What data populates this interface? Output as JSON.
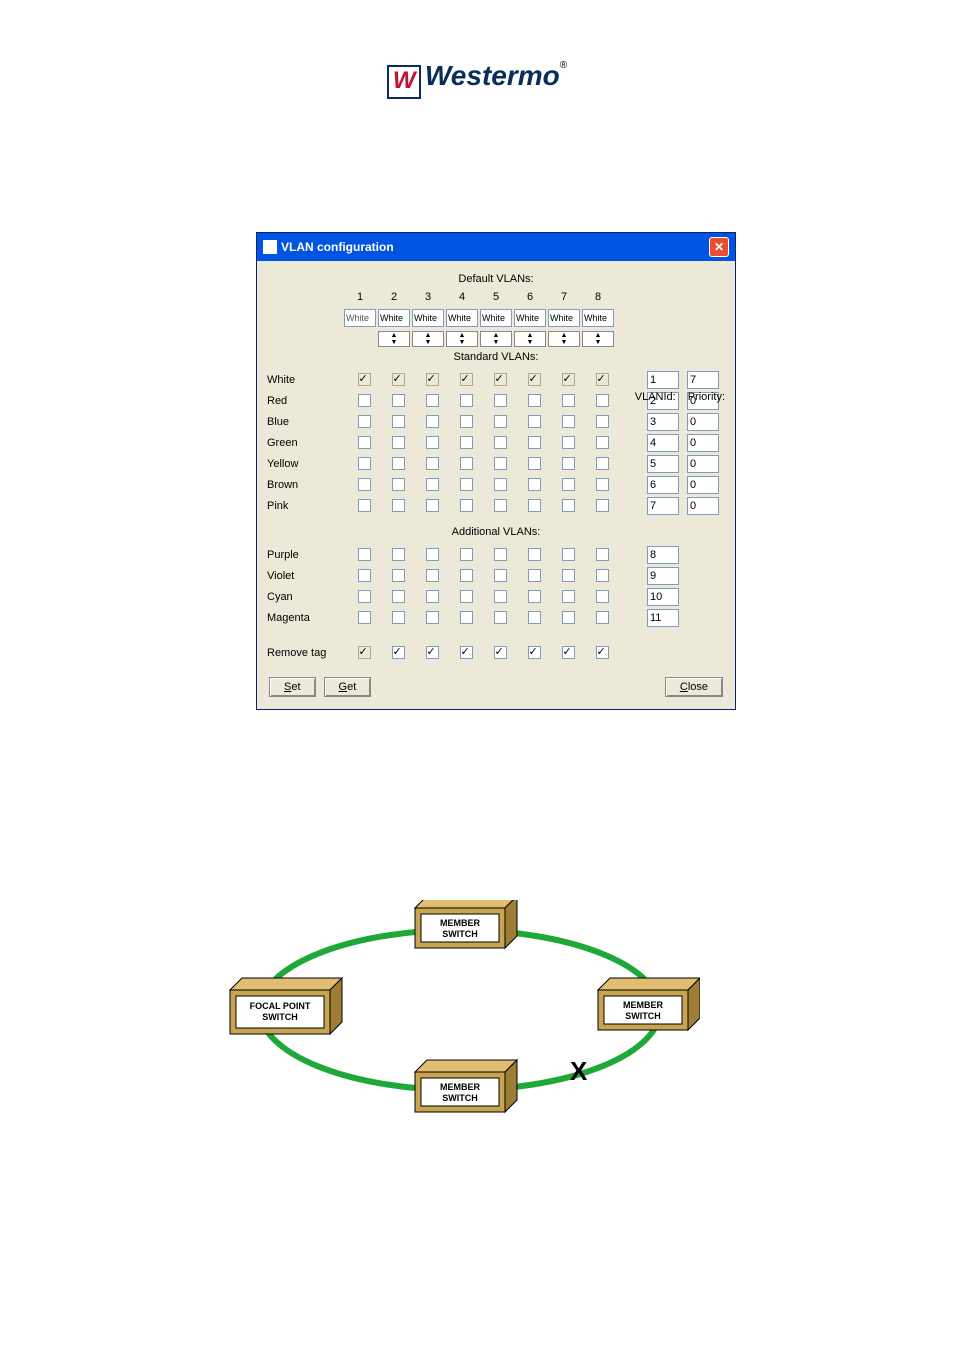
{
  "brand": {
    "name": "Westermo"
  },
  "window": {
    "title": "VLAN configuration",
    "sections": {
      "default_label": "Default VLANs:",
      "standard_label": "Standard VLANs:",
      "additional_label": "Additional VLANs:"
    },
    "ports": [
      "1",
      "2",
      "3",
      "4",
      "5",
      "6",
      "7",
      "8"
    ],
    "port_defaults": [
      "White",
      "White",
      "White",
      "White",
      "White",
      "White",
      "White",
      "White"
    ],
    "headers": {
      "vlanid": "VLANId:",
      "priority": "Priority:"
    },
    "standard_vlans": [
      {
        "name": "White",
        "ports": [
          true,
          true,
          true,
          true,
          true,
          true,
          true,
          true
        ],
        "disabled": true,
        "vlanid": "1",
        "priority": "7"
      },
      {
        "name": "Red",
        "ports": [
          false,
          false,
          false,
          false,
          false,
          false,
          false,
          false
        ],
        "vlanid": "2",
        "priority": "0"
      },
      {
        "name": "Blue",
        "ports": [
          false,
          false,
          false,
          false,
          false,
          false,
          false,
          false
        ],
        "vlanid": "3",
        "priority": "0"
      },
      {
        "name": "Green",
        "ports": [
          false,
          false,
          false,
          false,
          false,
          false,
          false,
          false
        ],
        "vlanid": "4",
        "priority": "0"
      },
      {
        "name": "Yellow",
        "ports": [
          false,
          false,
          false,
          false,
          false,
          false,
          false,
          false
        ],
        "vlanid": "5",
        "priority": "0"
      },
      {
        "name": "Brown",
        "ports": [
          false,
          false,
          false,
          false,
          false,
          false,
          false,
          false
        ],
        "vlanid": "6",
        "priority": "0"
      },
      {
        "name": "Pink",
        "ports": [
          false,
          false,
          false,
          false,
          false,
          false,
          false,
          false
        ],
        "vlanid": "7",
        "priority": "0"
      }
    ],
    "additional_vlans": [
      {
        "name": "Purple",
        "ports": [
          false,
          false,
          false,
          false,
          false,
          false,
          false,
          false
        ],
        "vlanid": "8"
      },
      {
        "name": "Violet",
        "ports": [
          false,
          false,
          false,
          false,
          false,
          false,
          false,
          false
        ],
        "vlanid": "9"
      },
      {
        "name": "Cyan",
        "ports": [
          false,
          false,
          false,
          false,
          false,
          false,
          false,
          false
        ],
        "vlanid": "10"
      },
      {
        "name": "Magenta",
        "ports": [
          false,
          false,
          false,
          false,
          false,
          false,
          false,
          false
        ],
        "vlanid": "11"
      }
    ],
    "remove_tag": {
      "label": "Remove tag",
      "ports": [
        true,
        true,
        true,
        true,
        true,
        true,
        true,
        true
      ],
      "first_disabled": true
    },
    "buttons": {
      "set": "Set",
      "get": "Get",
      "close": "Close"
    }
  },
  "diagram": {
    "focal": "FOCAL POINT SWITCH",
    "member": "MEMBER SWITCH",
    "break_mark": "X"
  }
}
